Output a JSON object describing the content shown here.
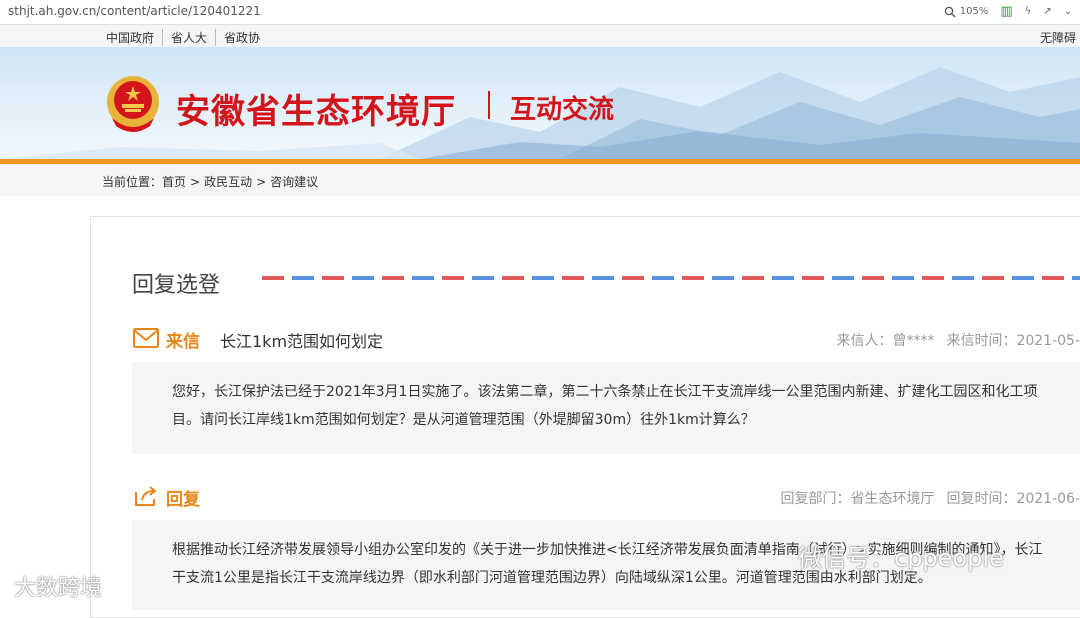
{
  "browser": {
    "url": "sthjt.ah.gov.cn/content/article/120401221",
    "zoom": "105%"
  },
  "topnav": {
    "links": [
      "中国政府",
      "省人大",
      "省政协"
    ],
    "accessibility": "无障碍"
  },
  "header": {
    "site_title": "安徽省生态环境厅",
    "section_title": "互动交流",
    "colors": {
      "title_red": "#d4141b",
      "accent_orange": "#f0951f"
    }
  },
  "breadcrumb": {
    "label": "当前位置：",
    "items": [
      "首页",
      "政民互动",
      "咨询建议"
    ],
    "separator": ">"
  },
  "page": {
    "section_heading": "回复选登"
  },
  "letter": {
    "label": "来信",
    "subject": "长江1km范围如何划定",
    "sender_label": "来信人：",
    "sender": "曾****",
    "time_label": "来信时间：",
    "time": "2021-05-",
    "body": [
      "您好，长江保护法已经于2021年3月1日实施了。该法第二章，第二十六条禁止在长江干支流岸线一公里范围内新建、扩建化工园区和化工项",
      "目。请问长江岸线1km范围如何划定？是从河道管理范围（外堤脚留30m）往外1km计算么？"
    ]
  },
  "reply": {
    "label": "回复",
    "dept_label": "回复部门：",
    "dept": "省生态环境厅",
    "time_label": "回复时间：",
    "time": "2021-06-",
    "body": [
      "根据推动长江经济带发展领导小组办公室印发的《关于进一步加快推进<长江经济带发展负面清单指南（试行）>实施细则编制的通知》，长江",
      "干支流1公里是指长江干支流岸线边界（即水利部门河道管理范围边界）向陆域纵深1公里。河道管理范围由水利部门划定。"
    ]
  },
  "watermarks": {
    "left": "大数跨境",
    "right": "微信号：cppeople"
  }
}
